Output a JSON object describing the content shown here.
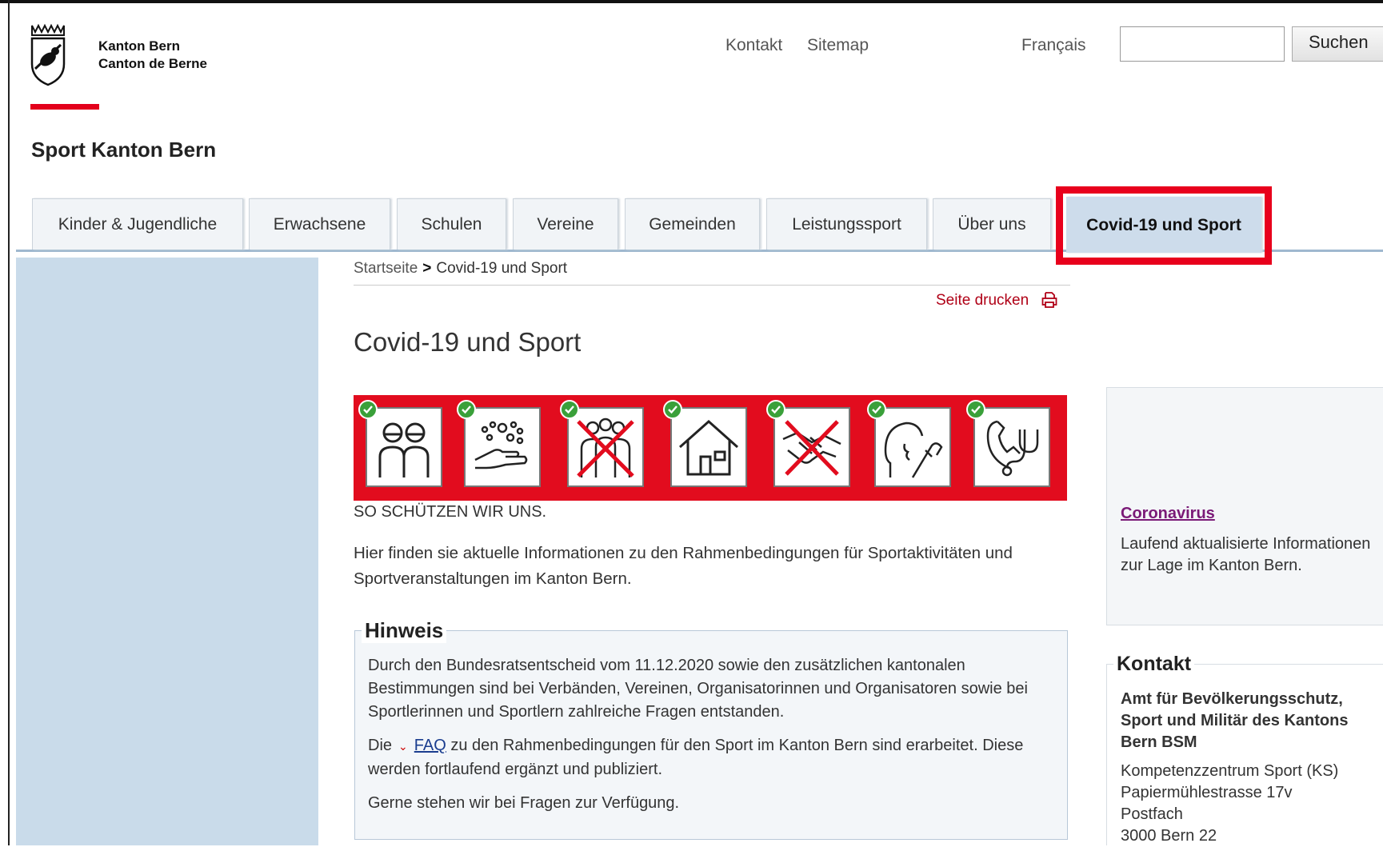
{
  "header": {
    "brand_line1": "Kanton Bern",
    "brand_line2": "Canton de Berne",
    "site_title": "Sport Kanton Bern",
    "meta_nav": [
      "Kontakt",
      "Sitemap"
    ],
    "language": "Français",
    "search": {
      "value": "",
      "button": "Suchen"
    }
  },
  "tabs": [
    {
      "label": "Kinder & Jugendliche",
      "active": false
    },
    {
      "label": "Erwachsene",
      "active": false
    },
    {
      "label": "Schulen",
      "active": false
    },
    {
      "label": "Vereine",
      "active": false
    },
    {
      "label": "Gemeinden",
      "active": false
    },
    {
      "label": "Leistungssport",
      "active": false
    },
    {
      "label": "Über uns",
      "active": false
    },
    {
      "label": "Covid-19 und Sport",
      "active": true
    }
  ],
  "breadcrumb": {
    "home": "Startseite",
    "separator": ">",
    "current": "Covid-19 und Sport"
  },
  "print_label": "Seite drucken",
  "page_title": "Covid-19 und Sport",
  "banner": {
    "icons": [
      "distance-people-icon",
      "hand-washing-icon",
      "no-groups-icon",
      "stay-home-icon",
      "no-handshake-icon",
      "cough-elbow-icon",
      "call-doctor-icon"
    ],
    "caption": "SO SCHÜTZEN WIR UNS."
  },
  "intro_text": "Hier finden sie aktuelle Informationen zu den Rahmenbedingungen für Sportaktivitäten und Sportveranstaltungen im Kanton Bern.",
  "hinweis": {
    "legend": "Hinweis",
    "p1": "Durch den Bundesratsentscheid vom 11.12.2020 sowie den zusätzlichen kantonalen Bestimmungen sind bei Verbänden, Vereinen, Organisatorinnen und Organisatoren sowie bei Sportlerinnen und Sportlern zahlreiche Fragen entstanden.",
    "p2_before": "Die",
    "p2_link": "FAQ",
    "p2_after": "zu den Rahmenbedingungen für den Sport im Kanton Bern sind erarbeitet. Diese werden fortlaufend ergänzt und publiziert.",
    "p3": "Gerne stehen wir bei Fragen zur Verfügung."
  },
  "sidebar_right": {
    "corona_link": "Coronavirus",
    "corona_text": "Laufend aktualisierte Informationen zur Lage im Kanton Bern.",
    "kontakt_legend": "Kontakt",
    "kontakt_org": "Amt für Bevölkerungsschutz, Sport und Militär des Kantons Bern BSM",
    "kontakt_lines": [
      "Kompetenzzentrum Sport (KS)",
      "Papiermühlestrasse 17v",
      "Postfach",
      "3000 Bern 22"
    ]
  },
  "colors": {
    "accent_red": "#e3001b",
    "nav_blue": "#cddceb",
    "sidebar_blue": "#c9dbea",
    "link_purple": "#7a1a77"
  }
}
